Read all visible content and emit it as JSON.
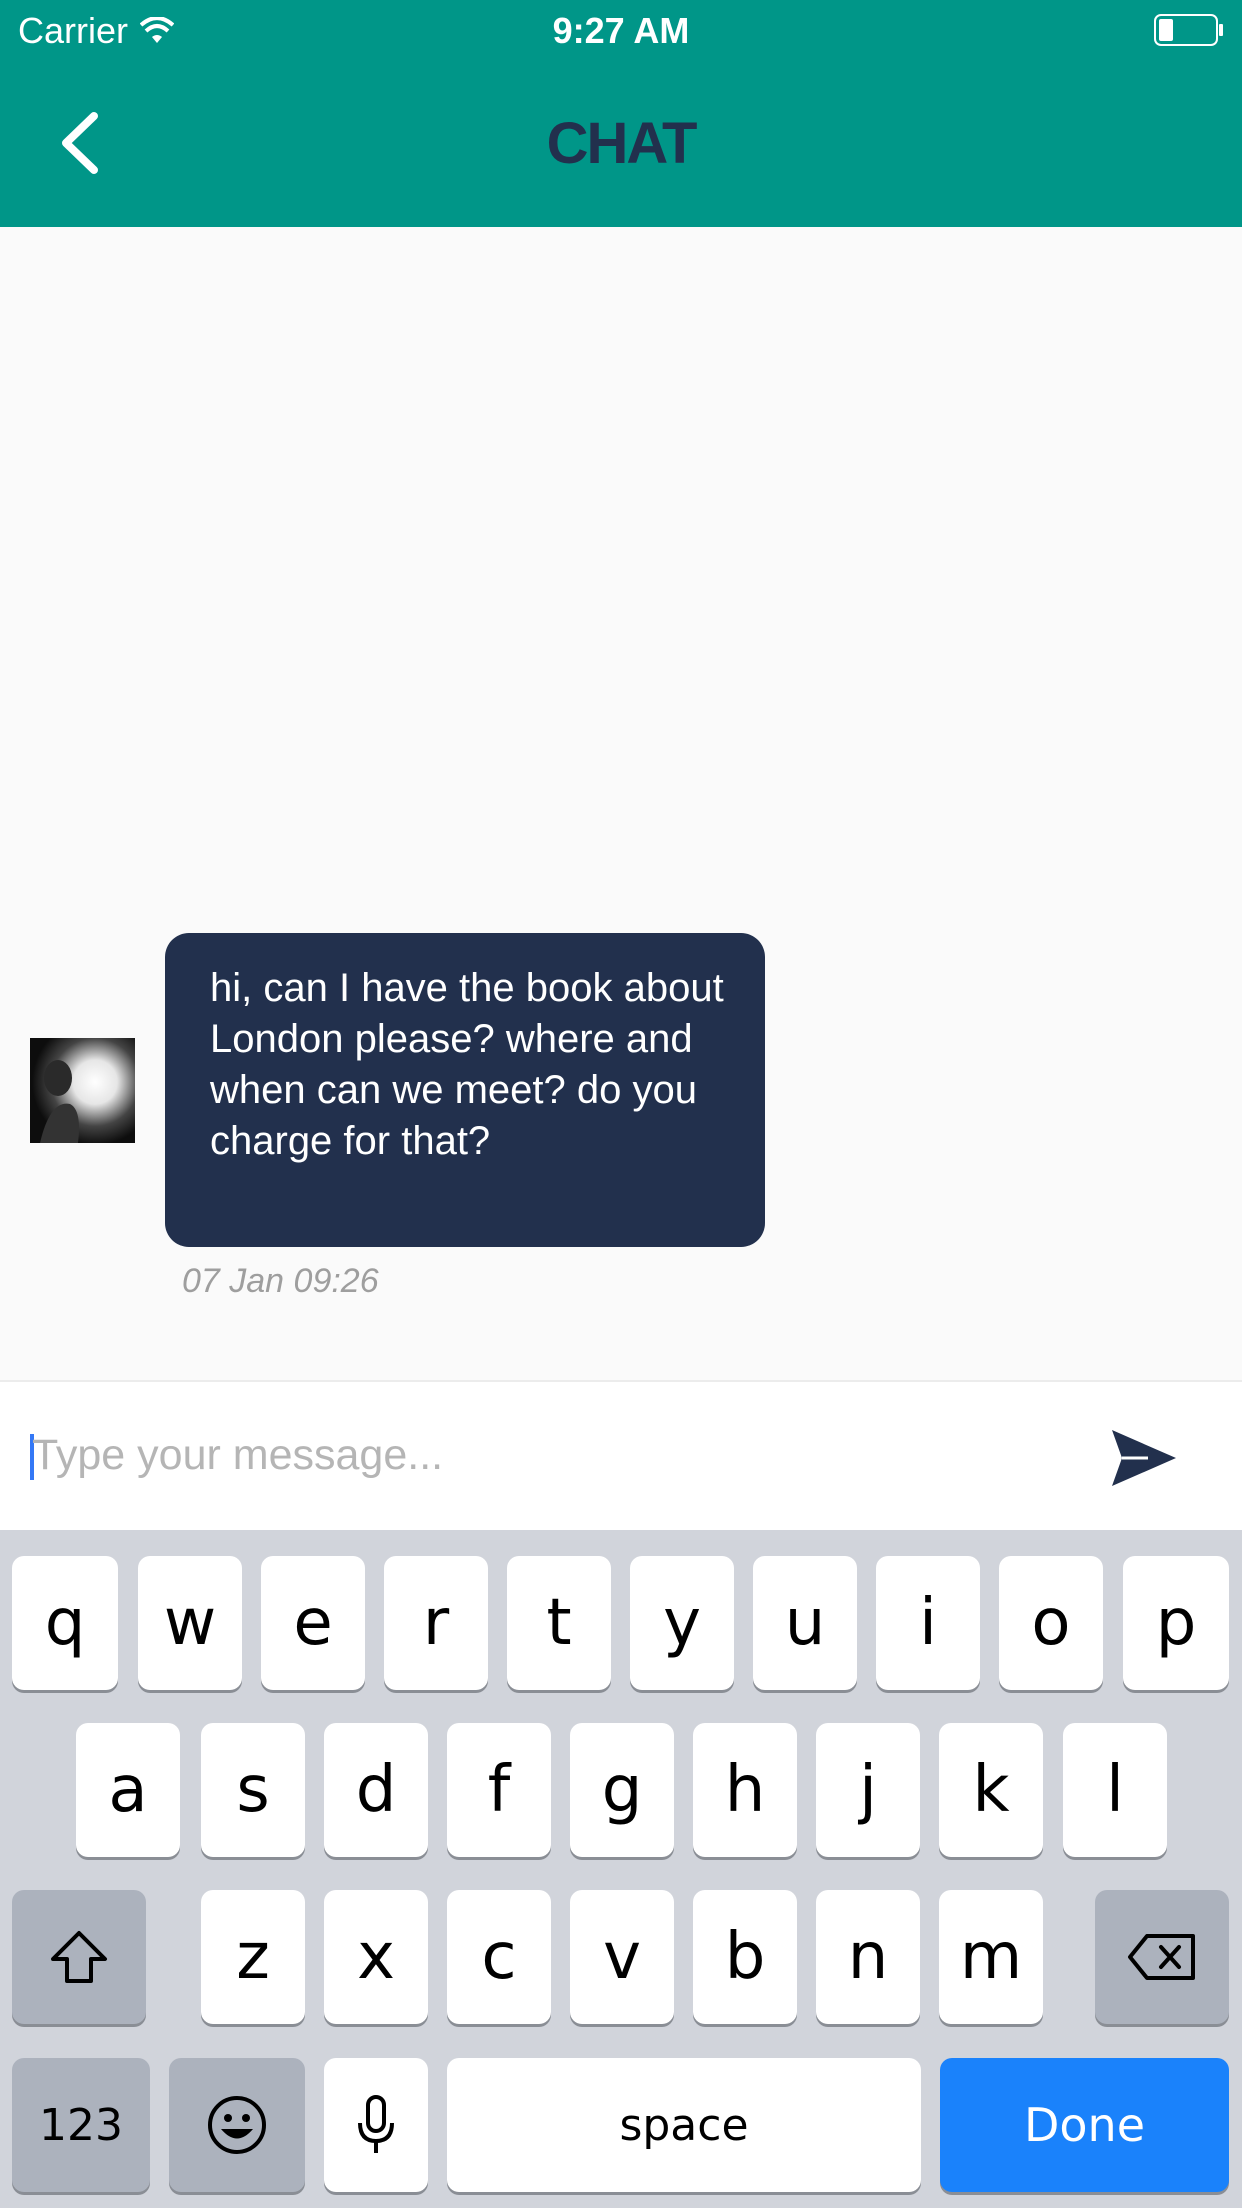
{
  "status_bar": {
    "carrier": "Carrier",
    "time": "9:27 AM"
  },
  "header": {
    "title": "CHAT",
    "back_icon": "chevron-left-icon"
  },
  "colors": {
    "header_bg": "#009688",
    "title": "#22304d",
    "bubble_bg": "#22304d",
    "accent_blue": "#1a82fb"
  },
  "messages": [
    {
      "text": "hi, can I have the book about London please? where and when can we meet? do you charge for that?",
      "timestamp": "07 Jan 09:26"
    }
  ],
  "composer": {
    "placeholder": "Type your message...",
    "value": "",
    "send_icon": "send-icon"
  },
  "keyboard": {
    "row1": [
      "q",
      "w",
      "e",
      "r",
      "t",
      "y",
      "u",
      "i",
      "o",
      "p"
    ],
    "row2": [
      "a",
      "s",
      "d",
      "f",
      "g",
      "h",
      "j",
      "k",
      "l"
    ],
    "row3": [
      "z",
      "x",
      "c",
      "v",
      "b",
      "n",
      "m"
    ],
    "numbers_label": "123",
    "space_label": "space",
    "done_label": "Done"
  }
}
